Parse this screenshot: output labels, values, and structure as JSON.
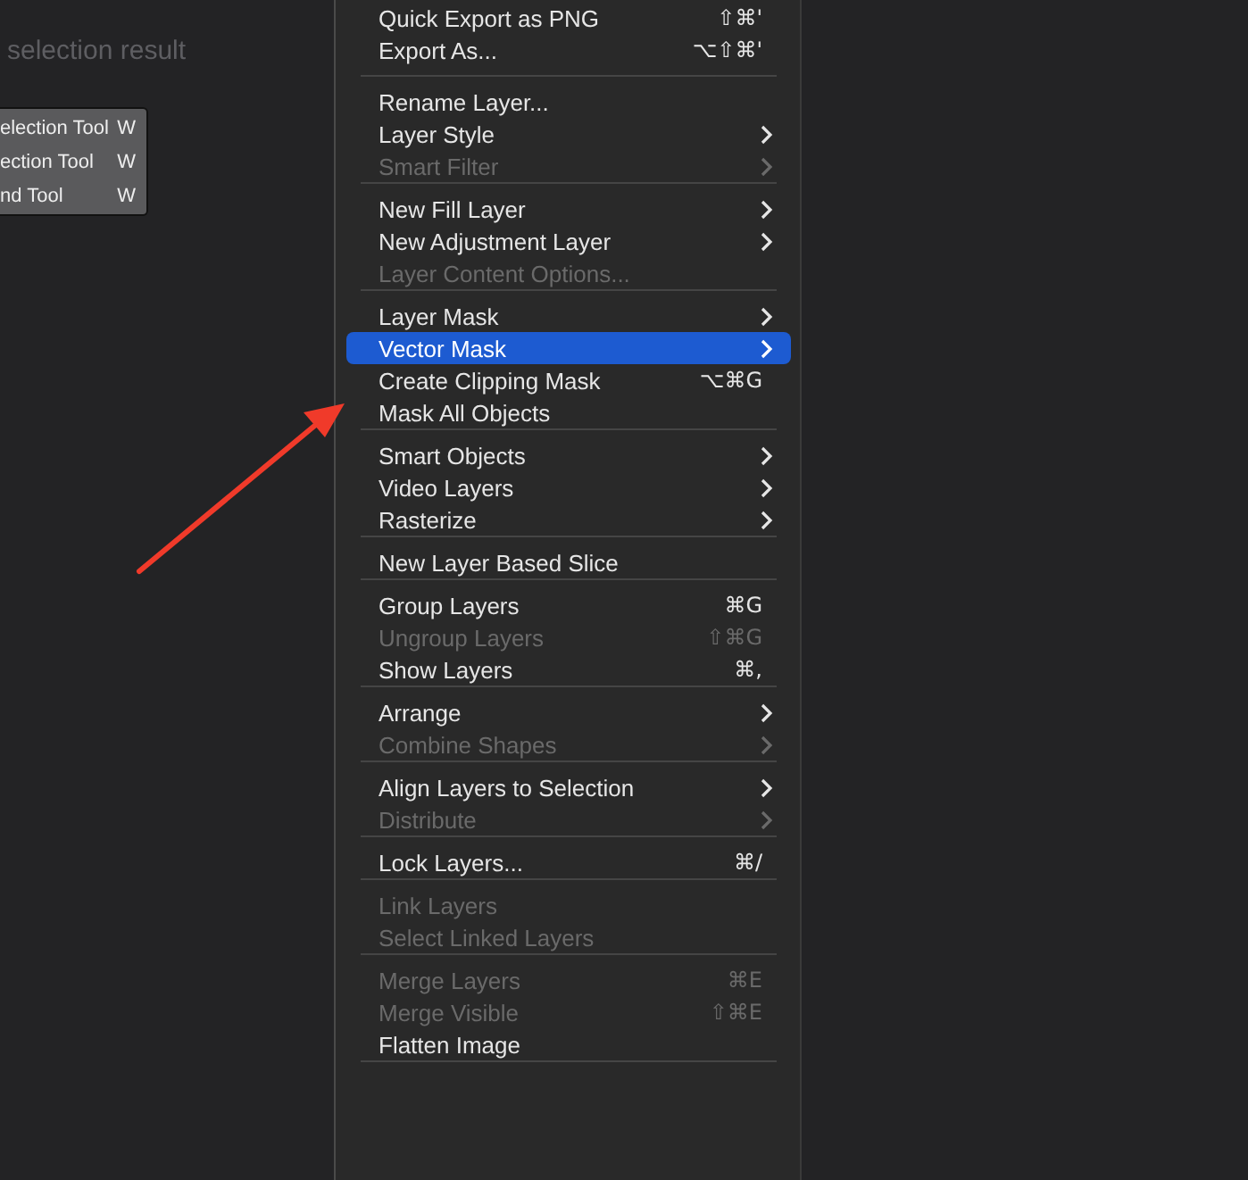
{
  "background_text": "selection result",
  "tool_popup": {
    "items": [
      {
        "label": "election Tool",
        "shortcut": "W"
      },
      {
        "label": "ection Tool",
        "shortcut": "W"
      },
      {
        "label": "nd Tool",
        "shortcut": "W"
      }
    ]
  },
  "menu": {
    "groups": [
      {
        "items": [
          {
            "label": "Quick Export as PNG",
            "shortcut": "⇧⌘'",
            "submenu": false,
            "disabled": false,
            "selected": false
          },
          {
            "label": "Export As...",
            "shortcut": "⌥⇧⌘'",
            "submenu": false,
            "disabled": false,
            "selected": false
          }
        ]
      },
      {
        "items": [
          {
            "label": "Rename Layer...",
            "submenu": false,
            "disabled": false,
            "selected": false
          },
          {
            "label": "Layer Style",
            "submenu": true,
            "disabled": false,
            "selected": false
          },
          {
            "label": "Smart Filter",
            "submenu": true,
            "disabled": true,
            "selected": false
          }
        ]
      },
      {
        "items": [
          {
            "label": "New Fill Layer",
            "submenu": true,
            "disabled": false,
            "selected": false
          },
          {
            "label": "New Adjustment Layer",
            "submenu": true,
            "disabled": false,
            "selected": false
          },
          {
            "label": "Layer Content Options...",
            "submenu": false,
            "disabled": true,
            "selected": false
          }
        ]
      },
      {
        "items": [
          {
            "label": "Layer Mask",
            "submenu": true,
            "disabled": false,
            "selected": false
          },
          {
            "label": "Vector Mask",
            "submenu": true,
            "disabled": false,
            "selected": true
          },
          {
            "label": "Create Clipping Mask",
            "shortcut": "⌥⌘G",
            "submenu": false,
            "disabled": false,
            "selected": false
          },
          {
            "label": "Mask All Objects",
            "submenu": false,
            "disabled": false,
            "selected": false
          }
        ]
      },
      {
        "items": [
          {
            "label": "Smart Objects",
            "submenu": true,
            "disabled": false,
            "selected": false
          },
          {
            "label": "Video Layers",
            "submenu": true,
            "disabled": false,
            "selected": false
          },
          {
            "label": "Rasterize",
            "submenu": true,
            "disabled": false,
            "selected": false
          }
        ]
      },
      {
        "items": [
          {
            "label": "New Layer Based Slice",
            "submenu": false,
            "disabled": false,
            "selected": false
          }
        ]
      },
      {
        "items": [
          {
            "label": "Group Layers",
            "shortcut": "⌘G",
            "submenu": false,
            "disabled": false,
            "selected": false
          },
          {
            "label": "Ungroup Layers",
            "shortcut": "⇧⌘G",
            "submenu": false,
            "disabled": true,
            "selected": false
          },
          {
            "label": "Show Layers",
            "shortcut": "⌘,",
            "submenu": false,
            "disabled": false,
            "selected": false
          }
        ]
      },
      {
        "items": [
          {
            "label": "Arrange",
            "submenu": true,
            "disabled": false,
            "selected": false
          },
          {
            "label": "Combine Shapes",
            "submenu": true,
            "disabled": true,
            "selected": false
          }
        ]
      },
      {
        "items": [
          {
            "label": "Align Layers to Selection",
            "submenu": true,
            "disabled": false,
            "selected": false
          },
          {
            "label": "Distribute",
            "submenu": true,
            "disabled": true,
            "selected": false
          }
        ]
      },
      {
        "items": [
          {
            "label": "Lock Layers...",
            "shortcut": "⌘/",
            "submenu": false,
            "disabled": false,
            "selected": false
          }
        ]
      },
      {
        "items": [
          {
            "label": "Link Layers",
            "submenu": false,
            "disabled": true,
            "selected": false
          },
          {
            "label": "Select Linked Layers",
            "submenu": false,
            "disabled": true,
            "selected": false
          }
        ]
      },
      {
        "items": [
          {
            "label": "Merge Layers",
            "shortcut": "⌘E",
            "submenu": false,
            "disabled": true,
            "selected": false
          },
          {
            "label": "Merge Visible",
            "shortcut": "⇧⌘E",
            "submenu": false,
            "disabled": true,
            "selected": false
          },
          {
            "label": "Flatten Image",
            "submenu": false,
            "disabled": false,
            "selected": false
          }
        ]
      }
    ]
  }
}
